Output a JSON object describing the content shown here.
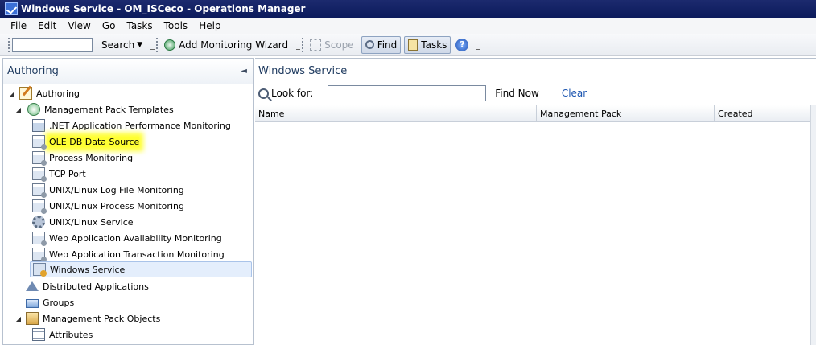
{
  "window": {
    "title": "Windows Service - OM_ISCeco - Operations Manager"
  },
  "menu": [
    "File",
    "Edit",
    "View",
    "Go",
    "Tasks",
    "Tools",
    "Help"
  ],
  "toolbar": {
    "search_label": "Search",
    "wizard_label": "Add Monitoring Wizard",
    "scope_label": "Scope",
    "find_label": "Find",
    "tasks_label": "Tasks"
  },
  "navigation": {
    "header": "Authoring",
    "tree": [
      {
        "label": "Authoring",
        "icon": "authoring-icon"
      },
      {
        "label": "Management Pack Templates",
        "icon": "template-group-icon"
      },
      {
        "label": ".NET Application Performance Monitoring",
        "icon": "net-app-icon"
      },
      {
        "label": "OLE DB Data Source",
        "icon": "template-icon",
        "highlighted": true
      },
      {
        "label": "Process Monitoring",
        "icon": "template-icon"
      },
      {
        "label": "TCP Port",
        "icon": "template-icon"
      },
      {
        "label": "UNIX/Linux Log File Monitoring",
        "icon": "template-icon"
      },
      {
        "label": "UNIX/Linux Process Monitoring",
        "icon": "template-icon"
      },
      {
        "label": "UNIX/Linux Service",
        "icon": "gear-icon"
      },
      {
        "label": "Web Application Availability Monitoring",
        "icon": "template-icon"
      },
      {
        "label": "Web Application Transaction Monitoring",
        "icon": "template-icon"
      },
      {
        "label": "Windows Service",
        "icon": "windows-service-icon",
        "selected": true
      },
      {
        "label": "Distributed Applications",
        "icon": "distributed-app-icon"
      },
      {
        "label": "Groups",
        "icon": "groups-icon"
      },
      {
        "label": "Management Pack Objects",
        "icon": "mp-objects-icon"
      },
      {
        "label": "Attributes",
        "icon": "attributes-icon"
      }
    ]
  },
  "main": {
    "title": "Windows Service",
    "look_for_label": "Look for:",
    "look_for_value": "",
    "find_now_label": "Find Now",
    "clear_label": "Clear",
    "columns": [
      "Name",
      "Management Pack",
      "Created"
    ]
  },
  "colors": {
    "title_bar": "#0b1a5c",
    "highlight": "#ffff33",
    "selection": "#e4eefc",
    "link": "#1c55b0"
  }
}
